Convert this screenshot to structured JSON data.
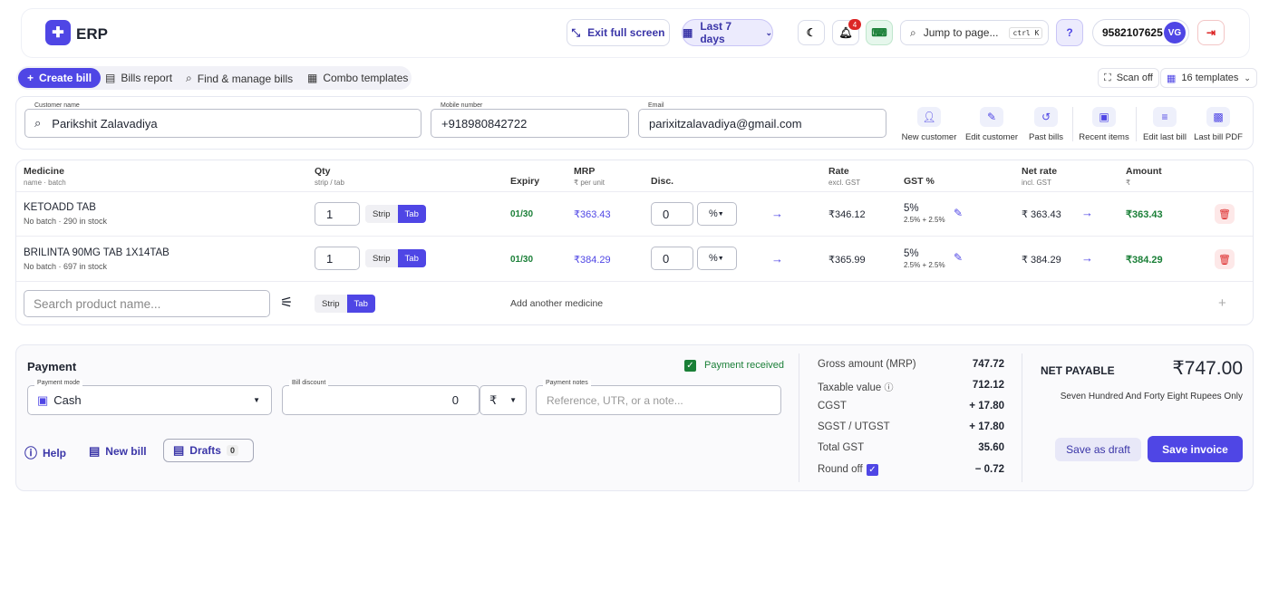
{
  "app": {
    "name": "ERP"
  },
  "header": {
    "exit_fullscreen": "Exit full screen",
    "date_range": "Last 7 days",
    "notification_count": "4",
    "jump_placeholder": "Jump to page...",
    "shortcut": "ctrl K",
    "help": "?",
    "phone": "9582107625",
    "avatar_initials": "VG"
  },
  "nav": {
    "create_bill": "Create bill",
    "bills_report": "Bills report",
    "find_manage": "Find & manage bills",
    "combo_templates": "Combo templates",
    "scan_off": "Scan off",
    "templates": "16 templates"
  },
  "customer": {
    "name_label": "Customer name",
    "name": "Parikshit Zalavadiya",
    "mobile_label": "Mobile number",
    "mobile": "+918980842722",
    "email_label": "Email",
    "email": "parixitzalavadiya@gmail.com",
    "actions": [
      "New customer",
      "Edit customer",
      "Past bills",
      "Recent items",
      "Edit last bill",
      "Last bill PDF"
    ]
  },
  "table": {
    "headers": {
      "medicine": "Medicine",
      "medicine_sub": "name · batch",
      "qty": "Qty",
      "qty_sub": "strip / tab",
      "expiry": "Expiry",
      "mrp": "MRP",
      "mrp_sub": "₹ per unit",
      "disc": "Disc.",
      "rate": "Rate",
      "rate_sub": "excl. GST",
      "gst": "GST %",
      "net": "Net rate",
      "net_sub": "incl. GST",
      "amount": "Amount",
      "amount_sub": "₹"
    },
    "rows": [
      {
        "name": "KETOADD TAB",
        "batch": "No batch · 290 in stock",
        "qty": "1",
        "strip": "Strip",
        "tab": "Tab",
        "expiry": "01/30",
        "mrp": "₹363.43",
        "disc": "0",
        "disc_type": "%",
        "rate": "₹346.12",
        "gst": "5%",
        "gst_split": "2.5% + 2.5%",
        "net": "₹ 363.43",
        "amount": "₹363.43"
      },
      {
        "name": "BRILINTA 90MG TAB 1X14TAB",
        "batch": "No batch · 697 in stock",
        "qty": "1",
        "strip": "Strip",
        "tab": "Tab",
        "expiry": "01/30",
        "mrp": "₹384.29",
        "disc": "0",
        "disc_type": "%",
        "rate": "₹365.99",
        "gst": "5%",
        "gst_split": "2.5% + 2.5%",
        "net": "₹ 384.29",
        "amount": "₹384.29"
      }
    ],
    "search_placeholder": "Search product name...",
    "strip": "Strip",
    "tab": "Tab",
    "add_another": "Add another medicine"
  },
  "payment": {
    "title": "Payment",
    "received": "Payment received",
    "mode_label": "Payment mode",
    "mode": "Cash",
    "discount_label": "Bill discount",
    "discount": "0",
    "discount_unit": "₹",
    "notes_label": "Payment notes",
    "notes_placeholder": "Reference, UTR, or a note...",
    "help": "Help",
    "new_bill": "New bill",
    "drafts": "Drafts",
    "drafts_count": "0"
  },
  "summary": {
    "items": [
      {
        "label": "Gross amount (MRP)",
        "value": "747.72"
      },
      {
        "label": "Taxable value",
        "value": "712.12"
      },
      {
        "label": "CGST",
        "value": "+ 17.80"
      },
      {
        "label": "SGST / UTGST",
        "value": "+ 17.80"
      },
      {
        "label": "Total GST",
        "value": "35.60"
      },
      {
        "label": "Round off",
        "value": "− 0.72"
      }
    ],
    "net_label": "NET PAYABLE",
    "net_value": "₹747.00",
    "words": "Seven Hundred And Forty Eight Rupees Only",
    "save_draft": "Save as draft",
    "save_invoice": "Save invoice"
  },
  "colors": {
    "accent": "#4f46e5",
    "green": "#1a7f37",
    "danger": "#dc2626"
  }
}
